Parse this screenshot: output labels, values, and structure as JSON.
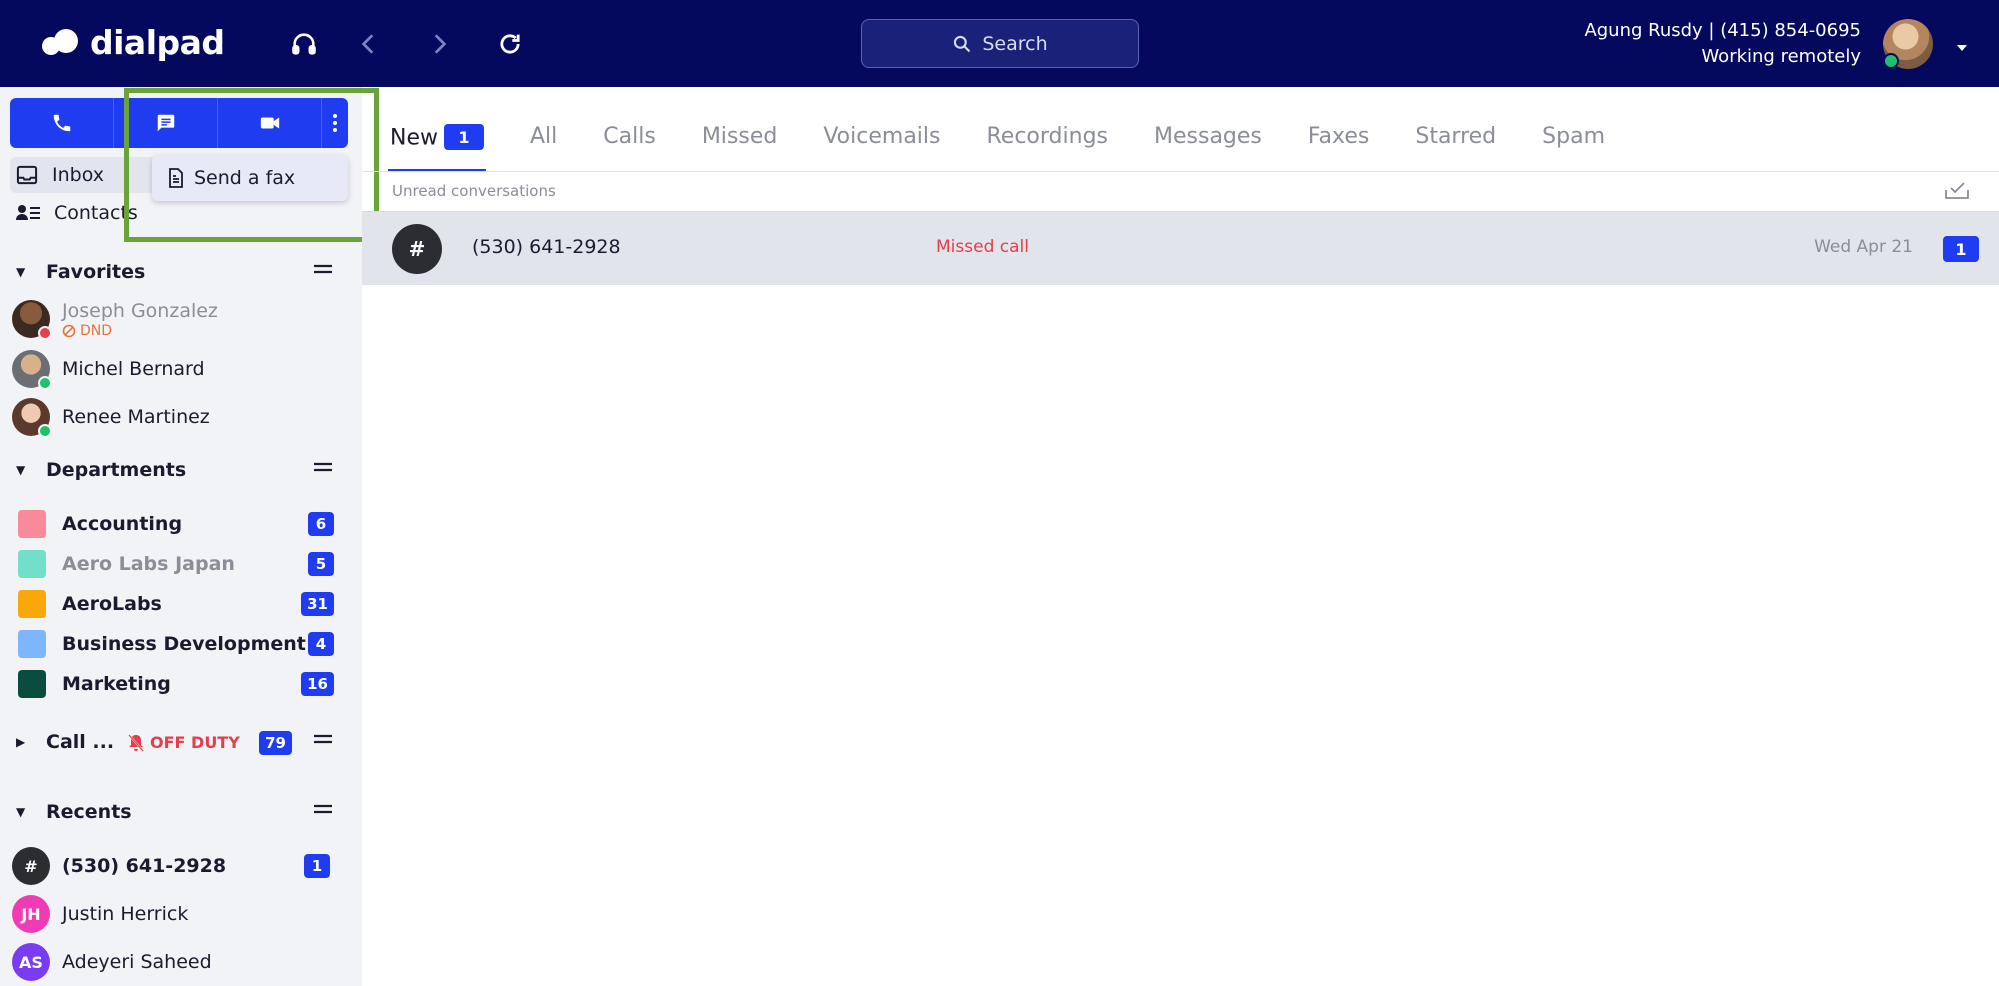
{
  "app": {
    "logo_text": "dialpad"
  },
  "header": {
    "search_placeholder": "Search",
    "user_line": "Agung Rusdy | (415) 854-0695",
    "user_status": "Working remotely"
  },
  "dropdown": {
    "send_fax_label": "Send a fax"
  },
  "nav": {
    "inbox_label": "Inbox",
    "contacts_label": "Contacts"
  },
  "favorites": {
    "title": "Favorites",
    "items": [
      {
        "name": "Joseph Gonzalez",
        "sub": "DND",
        "status_color": "#e53d4a"
      },
      {
        "name": "Michel Bernard",
        "status_color": "#1fc26b"
      },
      {
        "name": "Renee Martinez",
        "status_color": "#1fc26b"
      }
    ]
  },
  "departments": {
    "title": "Departments",
    "items": [
      {
        "name": "Accounting",
        "count": "6",
        "color": "#f98a9a"
      },
      {
        "name": "Aero Labs Japan",
        "count": "5",
        "color": "#72e0c8"
      },
      {
        "name": "AeroLabs",
        "count": "31",
        "color": "#f9a70a"
      },
      {
        "name": "Business Development",
        "count": "4",
        "color": "#7db5ff"
      },
      {
        "name": "Marketing",
        "count": "16",
        "color": "#0a4d40"
      }
    ]
  },
  "call_center": {
    "title": "Call ...",
    "off_duty_label": "OFF DUTY",
    "count": "79"
  },
  "recents": {
    "title": "Recents",
    "items": [
      {
        "avatar": "#",
        "name": "(530) 641-2928",
        "count": "1",
        "color": "#2b2d33"
      },
      {
        "avatar": "JH",
        "name": "Justin Herrick",
        "color": "#f03cb4"
      },
      {
        "avatar": "AS",
        "name": "Adeyeri Saheed",
        "color": "#7a3cf0"
      }
    ]
  },
  "tabs": {
    "items": [
      "New",
      "All",
      "Calls",
      "Missed",
      "Voicemails",
      "Recordings",
      "Messages",
      "Faxes",
      "Starred",
      "Spam"
    ],
    "new_count": "1"
  },
  "inbox": {
    "section_label": "Unread conversations",
    "rows": [
      {
        "avatar": "#",
        "number": "(530) 641-2928",
        "status": "Missed call",
        "date": "Wed Apr 21",
        "count": "1"
      }
    ]
  }
}
